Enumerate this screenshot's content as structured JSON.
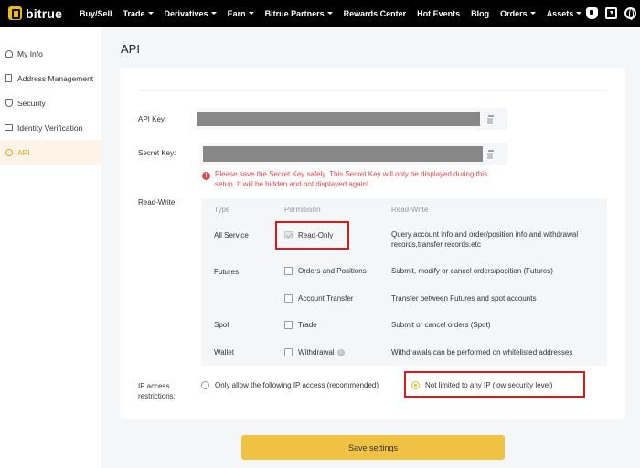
{
  "brand": {
    "name": "bitrue",
    "accent": "#f0b90b"
  },
  "nav": {
    "items": [
      {
        "label": "Buy/Sell",
        "caret": false
      },
      {
        "label": "Trade",
        "caret": true
      },
      {
        "label": "Derivatives",
        "caret": true
      },
      {
        "label": "Earn",
        "caret": true
      },
      {
        "label": "Bitrue Partners",
        "caret": true
      },
      {
        "label": "Rewards Center",
        "caret": false
      },
      {
        "label": "Hot Events",
        "caret": false
      },
      {
        "label": "Blog",
        "caret": false
      },
      {
        "label": "Orders",
        "caret": true
      },
      {
        "label": "Assets",
        "caret": true
      }
    ],
    "icons": [
      "shield-icon",
      "download-icon",
      "globe-icon"
    ]
  },
  "sidebar": {
    "items": [
      {
        "label": "My Info",
        "icon": "user-icon",
        "active": false
      },
      {
        "label": "Address Management",
        "icon": "address-book-icon",
        "active": false
      },
      {
        "label": "Security",
        "icon": "shield-icon",
        "active": false
      },
      {
        "label": "Identity Verification",
        "icon": "id-card-icon",
        "active": false
      },
      {
        "label": "API",
        "icon": "api-icon",
        "active": true
      }
    ]
  },
  "page": {
    "title": "API"
  },
  "api": {
    "api_key_label": "API Key:",
    "secret_key_label": "Secret Key:",
    "secret_warning": "Please save the Secret Key safely. This Secret Key will only be displayed during this setup. It will be hidden and not displayed again!",
    "read_write_label": "Read-Write:",
    "table": {
      "headers": {
        "type": "Type",
        "permission": "Permission",
        "read_write": "Read-Write"
      },
      "rows": [
        {
          "type": "All Service",
          "permission": "Read-Only",
          "description": "Query account info and order/position info and withdrawal records,transfer records.etc",
          "checked": true
        },
        {
          "type": "Futures",
          "permission": "Orders and Positions",
          "description": "Submit, modify or cancel orders/position (Futures)",
          "checked": false
        },
        {
          "type": "",
          "permission": "Account Transfer",
          "description": "Transfer between Futures and spot accounts",
          "checked": false
        },
        {
          "type": "Spot",
          "permission": "Trade",
          "description": "Submit or cancel orders (Spot)",
          "checked": false
        },
        {
          "type": "Wallet",
          "permission": "Withdrawal",
          "description": "Withdrawals can be performed on whitelisted addresses",
          "checked": false
        }
      ]
    },
    "ip": {
      "label_line1": "IP access",
      "label_line2": "restrictions:",
      "option_restricted": "Only allow the following IP access (recommended)",
      "option_unrestricted": "Not limited to any IP (low security level)",
      "selected": "unrestricted"
    },
    "save_label": "Save settings"
  }
}
